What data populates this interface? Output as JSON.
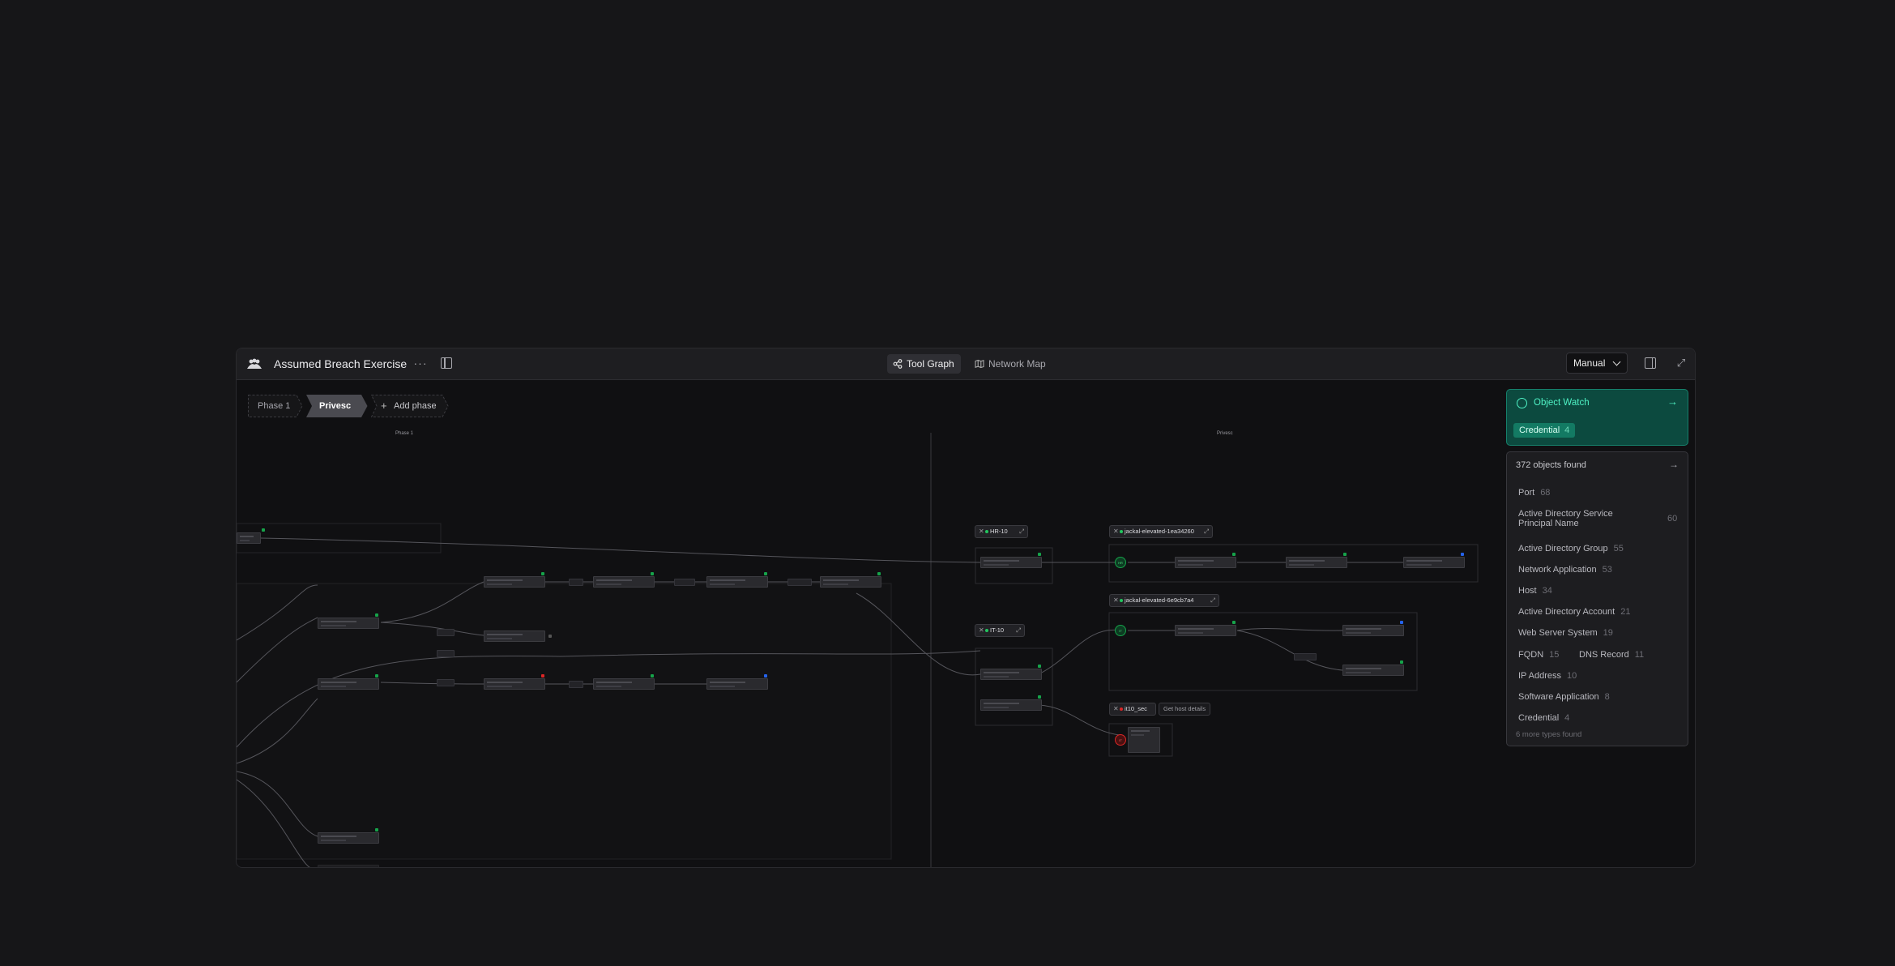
{
  "header": {
    "app_title": "Assumed Breach Exercise",
    "more_label": "···",
    "views": [
      {
        "label": "Tool Graph",
        "active": true
      },
      {
        "label": "Network Map",
        "active": false
      }
    ],
    "mode": "Manual"
  },
  "phases": [
    {
      "label": "Phase 1",
      "active": false
    },
    {
      "label": "Privesc",
      "active": true
    },
    {
      "label": "Add phase",
      "active": false
    }
  ],
  "canvas": {
    "phase1_label": "Phase 1",
    "privesc_label": "Privesc",
    "hosts": [
      {
        "label": "HR-10",
        "status": "green"
      },
      {
        "label": "jackal-elevated-1ea34260",
        "status": "green"
      },
      {
        "label": "jackal-elevated-6e9cb7a4",
        "status": "green"
      },
      {
        "label": "IT-10",
        "status": "green"
      },
      {
        "label": "it10_sec",
        "status": "red"
      }
    ],
    "get_host_details_label": "Get host details"
  },
  "object_watch": {
    "title": "Object Watch",
    "chip_label": "Credential",
    "chip_count": "4",
    "accent": "#4ff2c5"
  },
  "objects": {
    "header": "372 objects found",
    "items": [
      {
        "label": "Port",
        "count": "68"
      },
      {
        "label": "Active Directory Service Principal Name",
        "count": "60"
      },
      {
        "label": "Active Directory Group",
        "count": "55"
      },
      {
        "label": "Network Application",
        "count": "53"
      },
      {
        "label": "Host",
        "count": "34"
      },
      {
        "label": "Active Directory Account",
        "count": "21"
      },
      {
        "label": "Web Server System",
        "count": "19"
      },
      {
        "label": "FQDN",
        "count": "15"
      },
      {
        "label": "DNS Record",
        "count": "11"
      },
      {
        "label": "IP Address",
        "count": "10"
      },
      {
        "label": "Software Application",
        "count": "8"
      },
      {
        "label": "Credential",
        "count": "4"
      }
    ],
    "more": "6 more types found"
  }
}
